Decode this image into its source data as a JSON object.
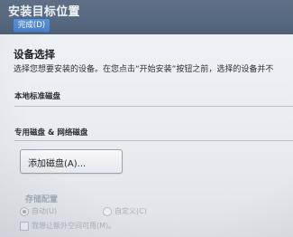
{
  "header": {
    "title": "安装目标位置",
    "done_label": "完成(D)"
  },
  "device_selection": {
    "title": "设备选择",
    "description": "选择您想要安装的设备。在您点击“开始安装”按钮之前，选择的设备并不"
  },
  "local_disks": {
    "label": "本地标准磁盘"
  },
  "special_disks": {
    "label": "专用磁盘 & 网络磁盘",
    "add_disk_label": "添加磁盘(A)..."
  },
  "storage_config": {
    "label": "存储配置",
    "auto_label": "自动(U)",
    "custom_label": "自定义(C)",
    "extra_space_label": "我想让额外空间可用(M)。"
  }
}
